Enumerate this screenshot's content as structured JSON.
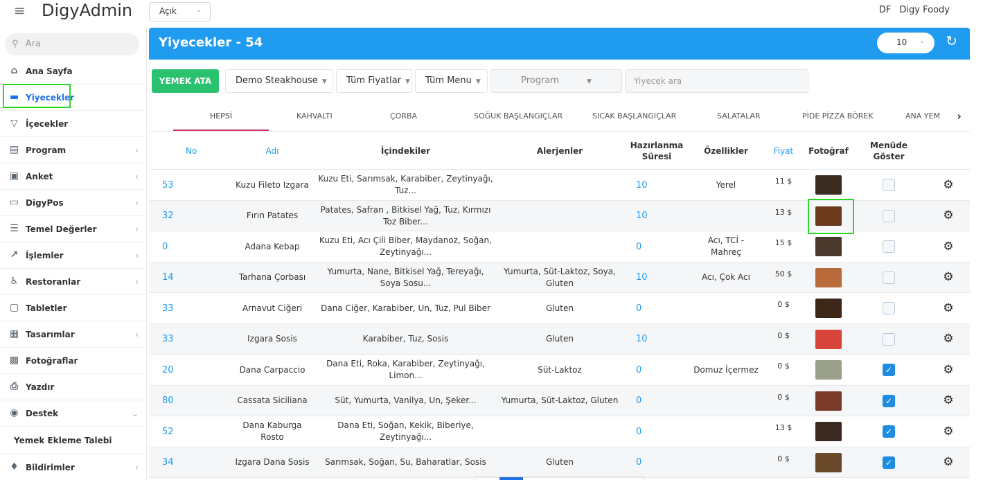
{
  "topbar": {
    "brand": "DigyAdmin",
    "mode_select": "Açık",
    "user_initials": "DF",
    "user_name": "Digy Foody"
  },
  "sidebar": {
    "search_placeholder": "Ara",
    "items": [
      {
        "label": "Ana Sayfa",
        "icon": "home-icon",
        "arrow": false
      },
      {
        "label": "Yiyecekler",
        "icon": "burger-icon",
        "arrow": false,
        "active": true
      },
      {
        "label": "İçecekler",
        "icon": "glass-icon",
        "arrow": false
      },
      {
        "label": "Program",
        "icon": "list-icon",
        "arrow": true
      },
      {
        "label": "Anket",
        "icon": "clipboard-icon",
        "arrow": true
      },
      {
        "label": "DigyPos",
        "icon": "card-icon",
        "arrow": true
      },
      {
        "label": "Temel Değerler",
        "icon": "layers-icon",
        "arrow": true
      },
      {
        "label": "İşlemler",
        "icon": "chart-icon",
        "arrow": true
      },
      {
        "label": "Restoranlar",
        "icon": "utensils-icon",
        "arrow": true
      },
      {
        "label": "Tabletler",
        "icon": "tablet-icon",
        "arrow": false
      },
      {
        "label": "Tasarımlar",
        "icon": "table-icon",
        "arrow": true
      },
      {
        "label": "Fotoğraflar",
        "icon": "image-icon",
        "arrow": false
      },
      {
        "label": "Yazdır",
        "icon": "printer-icon",
        "arrow": false
      },
      {
        "label": "Destek",
        "icon": "chat-icon",
        "arrow": true,
        "expanded": true
      }
    ],
    "subitem": "Yemek Ekleme Talebi",
    "bottom_item": "Bildirimler"
  },
  "header": {
    "title": "Yiyecekler - 54",
    "page_size": "10"
  },
  "filters": {
    "assign_button": "YEMEK ATA",
    "restaurant": "Demo Steakhouse",
    "prices": "Tüm Fiyatlar",
    "menus": "Tüm Menu",
    "program_placeholder": "Program",
    "search_placeholder": "Yiyecek ara"
  },
  "tabs": [
    "HEPSİ",
    "KAHVALTI",
    "ÇORBA",
    "SOĞUK BAŞLANGIÇLAR",
    "SICAK BAŞLANGIÇLAR",
    "SALATALAR",
    "PİDE PİZZA BÖREK",
    "ANA YEM"
  ],
  "columns": {
    "no": "No",
    "name": "Adı",
    "ingredients": "İçindekiler",
    "allergens": "Alerjenler",
    "prep_1": "Hazırlanma",
    "prep_2": "Süresi",
    "features": "Özellikler",
    "price": "Fiyat",
    "photo": "Fotoğraf",
    "menu_1": "Menüde",
    "menu_2": "Göster"
  },
  "rows": [
    {
      "no": "53",
      "name": "Kuzu Fileto Izgara",
      "ingredients": "Kuzu Eti, Sarımsak, Karabiber, Zeytinyağı, Tuz...",
      "allergens": "",
      "prep": "10",
      "features": "Yerel",
      "price": "11 $",
      "photo_color": "#3a2c20",
      "menu": false
    },
    {
      "no": "32",
      "name": "Fırın Patates",
      "ingredients": "Patates, Safran , Bitkisel Yağ, Tuz, Kırmızı Toz Biber...",
      "allergens": "",
      "prep": "10",
      "features": "",
      "price": "13 $",
      "photo_color": "#6b3a1c",
      "menu": false
    },
    {
      "no": "0",
      "name": "Adana Kebap",
      "ingredients": "Kuzu Eti, Acı Çili Biber, Maydanoz, Soğan, Zeytinyağı...",
      "allergens": "",
      "prep": "0",
      "features": "Acı, TCİ - Mahreç",
      "price": "15 $",
      "photo_color": "#4a3a2e",
      "menu": false
    },
    {
      "no": "14",
      "name": "Tarhana Çorbası",
      "ingredients": "Yumurta, Nane, Bitkisel Yağ, Tereyağı, Soya Sosu...",
      "allergens": "Yumurta, Süt-Laktoz, Soya, Gluten",
      "prep": "10",
      "features": "Acı, Çok Acı",
      "price": "50 $",
      "photo_color": "#b86a3a",
      "menu": false
    },
    {
      "no": "33",
      "name": "Arnavut Ciğeri",
      "ingredients": "Dana Ciğer, Karabiber, Un, Tuz, Pul Biber",
      "allergens": "Gluten",
      "prep": "0",
      "features": "",
      "price": "0 $",
      "photo_color": "#3b2618",
      "menu": false
    },
    {
      "no": "33",
      "name": "Izgara Sosis",
      "ingredients": "Karabiber, Tuz, Sosis",
      "allergens": "Gluten",
      "prep": "10",
      "features": "",
      "price": "0 $",
      "photo_color": "#d8453a",
      "menu": false
    },
    {
      "no": "20",
      "name": "Dana Carpaccio",
      "ingredients": "Dana Eti, Roka, Karabiber, Zeytinyağı, Limon...",
      "allergens": "Süt-Laktoz",
      "prep": "0",
      "features": "Domuz İçermez",
      "price": "0 $",
      "photo_color": "#9aa08a",
      "menu": true
    },
    {
      "no": "80",
      "name": "Cassata Siciliana",
      "ingredients": "Süt, Yumurta, Vanilya, Un, Şeker...",
      "allergens": "Yumurta, Süt-Laktoz, Gluten",
      "prep": "0",
      "features": "",
      "price": "0 $",
      "photo_color": "#7a3a2a",
      "menu": true
    },
    {
      "no": "52",
      "name": "Dana Kaburga Rosto",
      "ingredients": "Dana Eti, Soğan, Kekik, Biberiye, Zeytinyağı...",
      "allergens": "",
      "prep": "0",
      "features": "",
      "price": "13 $",
      "photo_color": "#3a2a22",
      "menu": true
    },
    {
      "no": "34",
      "name": "Izgara Dana Sosis",
      "ingredients": "Sarımsak, Soğan, Su, Baharatlar, Sosis",
      "allergens": "Gluten",
      "prep": "0",
      "features": "",
      "price": "0 $",
      "photo_color": "#6a4a2a",
      "menu": true
    }
  ]
}
